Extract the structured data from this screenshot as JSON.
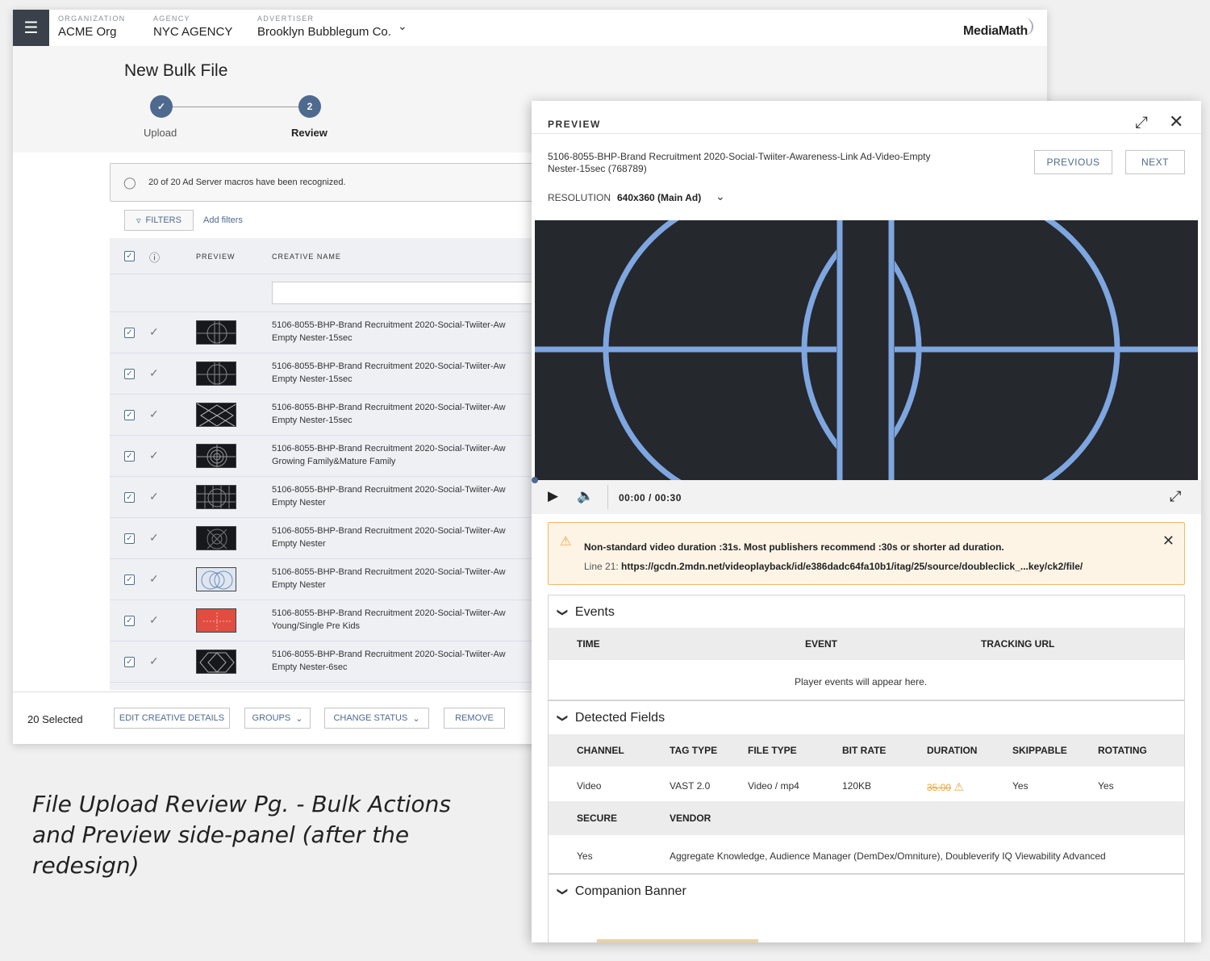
{
  "header": {
    "menu_icon": "hamburger-icon",
    "organization": {
      "label": "ORGANIZATION",
      "value": "ACME Org"
    },
    "agency": {
      "label": "AGENCY",
      "value": "NYC AGENCY"
    },
    "advertiser": {
      "label": "ADVERTISER",
      "value": "Brooklyn Bubblegum Co."
    },
    "brand": "MediaMath"
  },
  "page": {
    "title": "New Bulk File",
    "steps": [
      {
        "label": "Upload",
        "marker": "✓",
        "status": "complete"
      },
      {
        "label": "Review",
        "marker": "2",
        "status": "current"
      }
    ],
    "banner": "20 of 20 Ad Server macros have been recognized.",
    "filters_label": "FILTERS",
    "add_filters": "Add filters"
  },
  "table": {
    "columns": {
      "preview": "PREVIEW",
      "creative_name": "CREATIVE NAME"
    },
    "rows": [
      {
        "line1": "5106-8055-BHP-Brand Recruitment 2020-Social-Twiiter-Aw",
        "line2": "Empty Nester-15sec",
        "thumb": "crosshair"
      },
      {
        "line1": "5106-8055-BHP-Brand Recruitment 2020-Social-Twiiter-Aw",
        "line2": "Empty Nester-15sec",
        "thumb": "crosshair"
      },
      {
        "line1": "5106-8055-BHP-Brand Recruitment 2020-Social-Twiiter-Aw",
        "line2": "Empty Nester-15sec",
        "thumb": "diamond"
      },
      {
        "line1": "5106-8055-BHP-Brand Recruitment 2020-Social-Twiiter-Aw",
        "line2": "Growing Family&Mature Family",
        "thumb": "target"
      },
      {
        "line1": "5106-8055-BHP-Brand Recruitment 2020-Social-Twiiter-Aw",
        "line2": "Empty Nester",
        "thumb": "grid"
      },
      {
        "line1": "5106-8055-BHP-Brand Recruitment 2020-Social-Twiiter-Aw",
        "line2": "Empty Nester",
        "thumb": "wheel"
      },
      {
        "line1": "5106-8055-BHP-Brand Recruitment 2020-Social-Twiiter-Aw",
        "line2": "Empty Nester",
        "thumb": "rings"
      },
      {
        "line1": "5106-8055-BHP-Brand Recruitment 2020-Social-Twiiter-Aw",
        "line2": "Young/Single Pre Kids",
        "thumb": "red"
      },
      {
        "line1": "5106-8055-BHP-Brand Recruitment 2020-Social-Twiiter-Aw",
        "line2": "Empty Nester-6sec",
        "thumb": "hexagon"
      }
    ]
  },
  "bottom_bar": {
    "selected": "20 Selected",
    "edit": "EDIT CREATIVE DETAILS",
    "groups": "GROUPS",
    "change_status": "CHANGE STATUS",
    "remove": "REMOVE"
  },
  "preview": {
    "title": "PREVIEW",
    "name_line1": "5106-8055-BHP-Brand Recruitment 2020-Social-Twiiter-Awareness-Link Ad-Video-Empty",
    "name_line2": "Nester-15sec (768789)",
    "previous": "PREVIOUS",
    "next": "NEXT",
    "resolution_label": "RESOLUTION",
    "resolution_value": "640x360 (Main Ad)",
    "time": "00:00 / 00:30",
    "warning": {
      "message": "Non-standard video duration :31s. Most publishers recommend :30s or shorter ad duration.",
      "line_label": "Line 21:",
      "url": "https://gcdn.2mdn.net/videoplayback/id/e386dadc64fa10b1/itag/25/source/doubleclick_...key/ck2/file/"
    },
    "events": {
      "title": "Events",
      "columns": [
        "TIME",
        "EVENT",
        "TRACKING URL"
      ],
      "empty": "Player events will appear here."
    },
    "detected_fields": {
      "title": "Detected Fields",
      "columns": [
        "CHANNEL",
        "TAG TYPE",
        "FILE TYPE",
        "BIT RATE",
        "DURATION",
        "SKIPPABLE",
        "ROTATING"
      ],
      "values": [
        "Video",
        "VAST 2.0",
        "Video / mp4",
        "120KB",
        "35:00",
        "Yes",
        "Yes"
      ],
      "columns2": [
        "SECURE",
        "VENDOR"
      ],
      "values2": [
        "Yes",
        "Aggregate Knowledge, Audience Manager (DemDex/Omniture), Doubleverify IQ Viewability Advanced"
      ]
    },
    "companion": {
      "title": "Companion Banner"
    }
  },
  "caption": "File Upload Review Pg. - Bulk Actions and Preview side-panel (after the redesign)",
  "colors": {
    "accent": "#4f6a8f",
    "warning": "#f0a43c",
    "video_bg": "#25282d",
    "video_lines": "#7ea6e0"
  }
}
